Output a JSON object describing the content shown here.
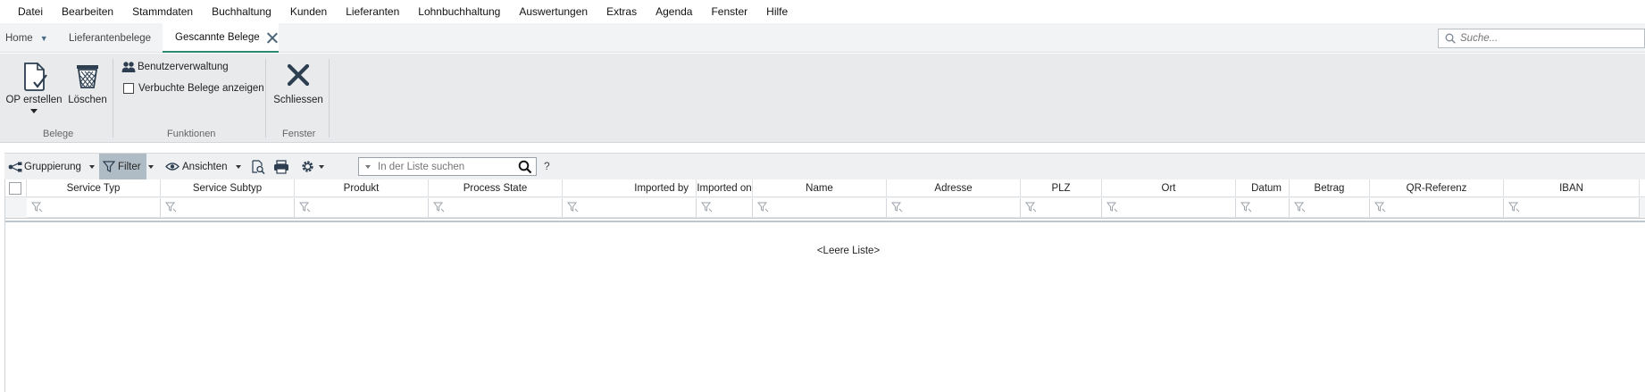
{
  "menu": [
    "Datei",
    "Bearbeiten",
    "Stammdaten",
    "Buchhaltung",
    "Kunden",
    "Lieferanten",
    "Lohnbuchhaltung",
    "Auswertungen",
    "Extras",
    "Agenda",
    "Fenster",
    "Hilfe"
  ],
  "tabs": {
    "home": "Home",
    "lieferantenbelege": "Lieferantenbelege",
    "active": "Gescannte Belege"
  },
  "global_search": {
    "placeholder": "Suche..."
  },
  "ribbon": {
    "op_erstellen": "OP erstellen",
    "loeschen": "Löschen",
    "group_belege": "Belege",
    "benutzerverwaltung": "Benutzerverwaltung",
    "verbuchte_belege": "Verbuchte Belege anzeigen",
    "verbuchte_belege_checked": false,
    "group_funktionen": "Funktionen",
    "schliessen": "Schliessen",
    "group_fenster": "Fenster"
  },
  "toolbar": {
    "gruppierung": "Gruppierung",
    "filter": "Filter",
    "ansichten": "Ansichten",
    "list_search_placeholder": "In der Liste suchen",
    "help": "?"
  },
  "grid": {
    "columns": [
      "Service Typ",
      "Service Subtyp",
      "Produkt",
      "Process State",
      "Imported by",
      "Imported on",
      "Name",
      "Adresse",
      "PLZ",
      "Ort",
      "Datum",
      "Betrag",
      "QR-Referenz",
      "IBAN"
    ],
    "rows": [],
    "empty_text": "<Leere Liste>"
  },
  "colors": {
    "accent_tab_underline": "#2c8a73",
    "ribbon_bg": "#e8eaec",
    "filter_active_bg": "#b0bcc5"
  }
}
